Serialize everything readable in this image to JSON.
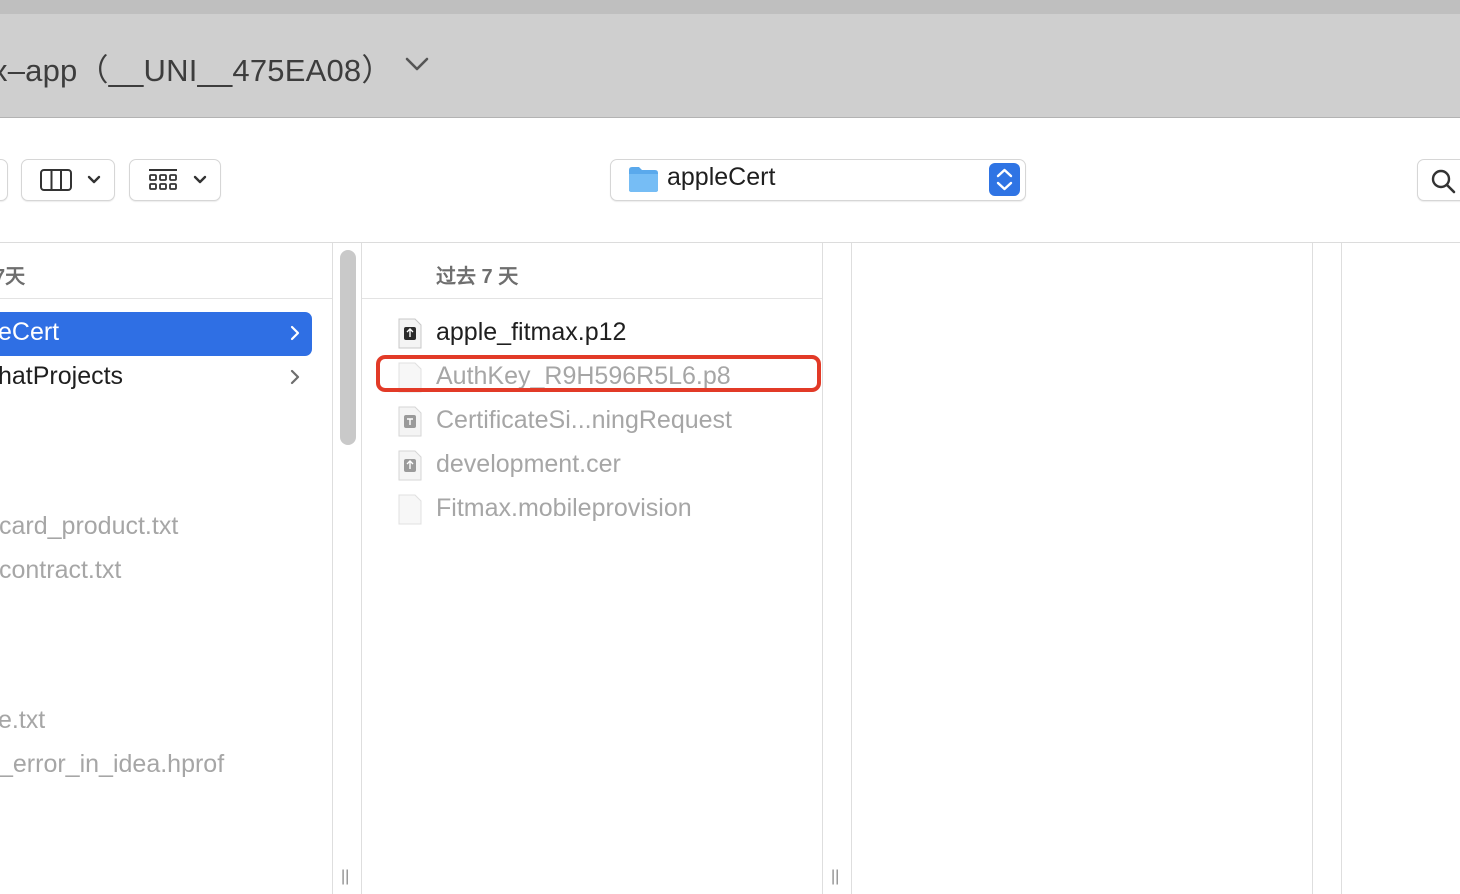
{
  "window": {
    "title": "x–app（__UNI__475EA08）"
  },
  "toolbar": {
    "path_popup_label": "appleCert"
  },
  "left_column": {
    "header": "7天",
    "selected_item": "eCert",
    "items": [
      {
        "label": "hatProjects"
      },
      {
        "label": "card_product.txt"
      },
      {
        "label": "contract.txt"
      },
      {
        "label": "e.txt"
      },
      {
        "label": "_error_in_idea.hprof"
      }
    ]
  },
  "middle_column": {
    "header": "过去 7 天",
    "files": [
      {
        "label": "apple_fitmax.p12",
        "icon": "certificate-file-icon",
        "dimmed": false
      },
      {
        "label": "AuthKey_R9H596R5L6.p8",
        "icon": "blank-file-icon",
        "dimmed": true
      },
      {
        "label": "CertificateSi...ningRequest",
        "icon": "request-file-icon",
        "dimmed": true
      },
      {
        "label": "development.cer",
        "icon": "certificate-file-icon",
        "dimmed": true
      },
      {
        "label": "Fitmax.mobileprovision",
        "icon": "blank-file-icon",
        "dimmed": true
      }
    ]
  },
  "colors": {
    "selection": "#2f6fe4",
    "stepper": "#2f74e4",
    "highlight": "#e23a27",
    "title_bar": "#cfcfcf"
  }
}
